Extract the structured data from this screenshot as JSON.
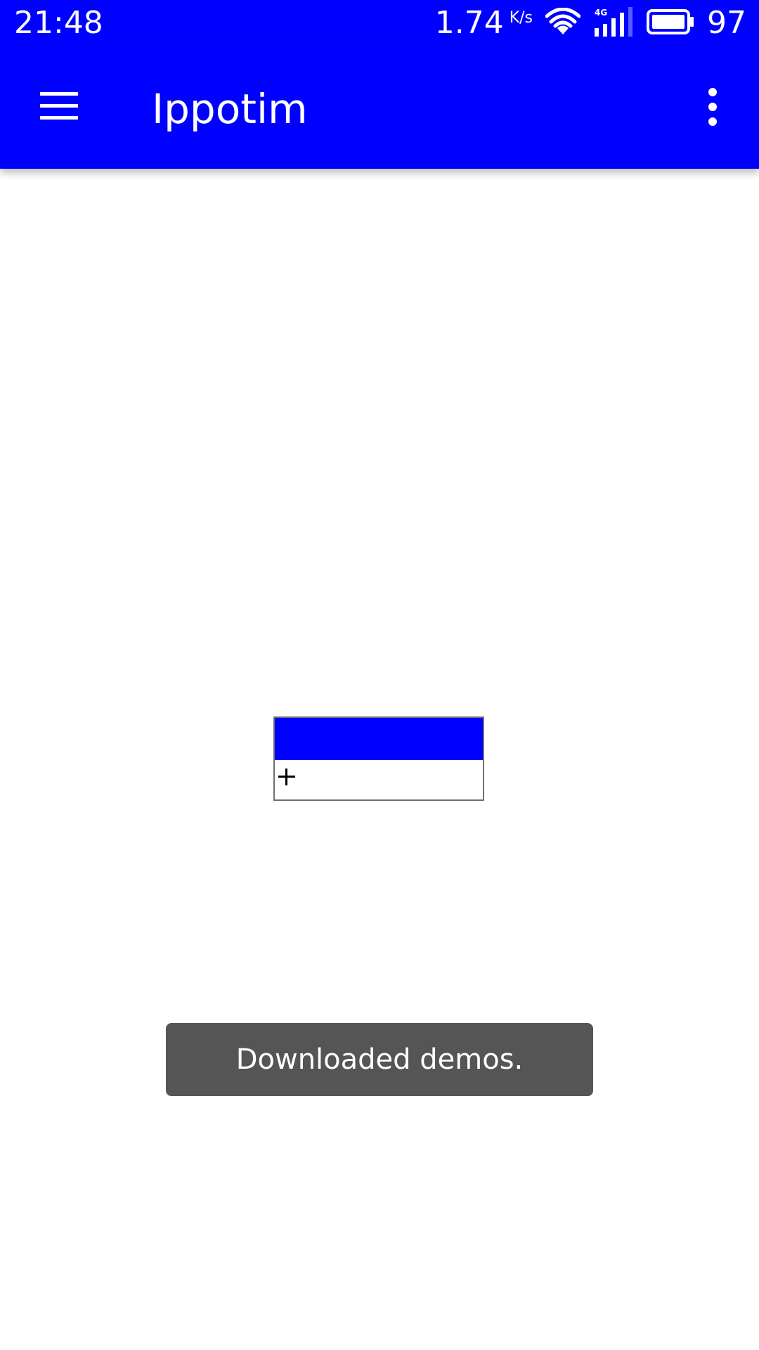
{
  "status_bar": {
    "time": "21:48",
    "net_speed": "1.74",
    "net_unit": "K/s",
    "battery_level": "97",
    "icons": [
      "wifi-icon",
      "signal-4g-icon",
      "battery-icon"
    ]
  },
  "toolbar": {
    "title": "Ippotim",
    "menu_icon": "hamburger-menu-icon",
    "overflow_icon": "more-vert-icon"
  },
  "widget": {
    "add_icon": "plus-icon"
  },
  "toast": {
    "message": "Downloaded demos."
  },
  "colors": {
    "primary": "#0000ff",
    "toast_bg": "#555555",
    "background": "#ffffff"
  }
}
